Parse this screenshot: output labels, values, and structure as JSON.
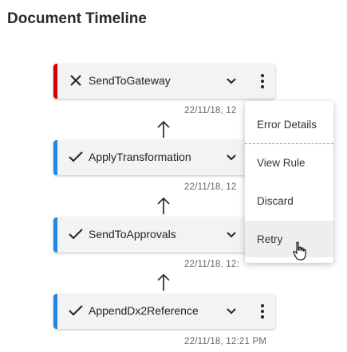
{
  "page": {
    "title": "Document Timeline"
  },
  "timeline": [
    {
      "name": "SendToGateway",
      "status": "error",
      "timestamp": "22/11/18, 12"
    },
    {
      "name": "ApplyTransformation",
      "status": "success",
      "timestamp": "22/11/18, 12"
    },
    {
      "name": "SendToApprovals",
      "status": "success",
      "timestamp": "22/11/18, 12:"
    },
    {
      "name": "AppendDx2Reference",
      "status": "success",
      "timestamp": "22/11/18, 12:21 PM"
    }
  ],
  "context_menu": {
    "items": [
      {
        "label": "Error Details"
      },
      {
        "label": "View Rule"
      },
      {
        "label": "Discard"
      },
      {
        "label": "Retry"
      }
    ],
    "hovered": "Retry"
  },
  "colors": {
    "error": "#d50000",
    "success": "#1e88e5"
  }
}
